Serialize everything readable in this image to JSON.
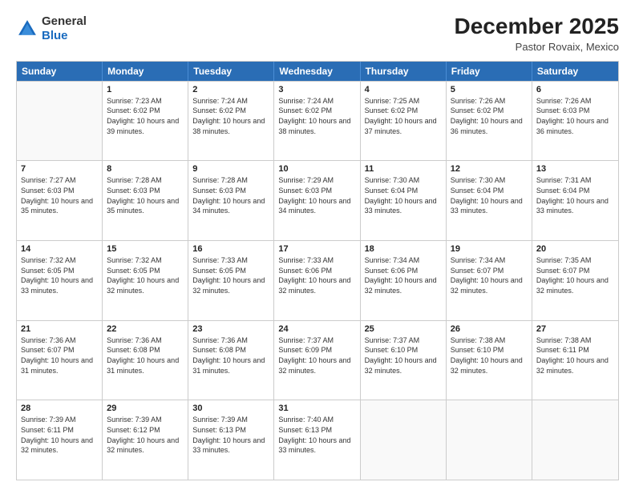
{
  "header": {
    "logo_general": "General",
    "logo_blue": "Blue",
    "month_title": "December 2025",
    "location": "Pastor Rovaix, Mexico"
  },
  "weekdays": [
    "Sunday",
    "Monday",
    "Tuesday",
    "Wednesday",
    "Thursday",
    "Friday",
    "Saturday"
  ],
  "weeks": [
    [
      {
        "day": "",
        "empty": true
      },
      {
        "day": "1",
        "sunrise": "7:23 AM",
        "sunset": "6:02 PM",
        "daylight": "10 hours and 39 minutes."
      },
      {
        "day": "2",
        "sunrise": "7:24 AM",
        "sunset": "6:02 PM",
        "daylight": "10 hours and 38 minutes."
      },
      {
        "day": "3",
        "sunrise": "7:24 AM",
        "sunset": "6:02 PM",
        "daylight": "10 hours and 38 minutes."
      },
      {
        "day": "4",
        "sunrise": "7:25 AM",
        "sunset": "6:02 PM",
        "daylight": "10 hours and 37 minutes."
      },
      {
        "day": "5",
        "sunrise": "7:26 AM",
        "sunset": "6:02 PM",
        "daylight": "10 hours and 36 minutes."
      },
      {
        "day": "6",
        "sunrise": "7:26 AM",
        "sunset": "6:03 PM",
        "daylight": "10 hours and 36 minutes."
      }
    ],
    [
      {
        "day": "7",
        "sunrise": "7:27 AM",
        "sunset": "6:03 PM",
        "daylight": "10 hours and 35 minutes."
      },
      {
        "day": "8",
        "sunrise": "7:28 AM",
        "sunset": "6:03 PM",
        "daylight": "10 hours and 35 minutes."
      },
      {
        "day": "9",
        "sunrise": "7:28 AM",
        "sunset": "6:03 PM",
        "daylight": "10 hours and 34 minutes."
      },
      {
        "day": "10",
        "sunrise": "7:29 AM",
        "sunset": "6:03 PM",
        "daylight": "10 hours and 34 minutes."
      },
      {
        "day": "11",
        "sunrise": "7:30 AM",
        "sunset": "6:04 PM",
        "daylight": "10 hours and 33 minutes."
      },
      {
        "day": "12",
        "sunrise": "7:30 AM",
        "sunset": "6:04 PM",
        "daylight": "10 hours and 33 minutes."
      },
      {
        "day": "13",
        "sunrise": "7:31 AM",
        "sunset": "6:04 PM",
        "daylight": "10 hours and 33 minutes."
      }
    ],
    [
      {
        "day": "14",
        "sunrise": "7:32 AM",
        "sunset": "6:05 PM",
        "daylight": "10 hours and 33 minutes."
      },
      {
        "day": "15",
        "sunrise": "7:32 AM",
        "sunset": "6:05 PM",
        "daylight": "10 hours and 32 minutes."
      },
      {
        "day": "16",
        "sunrise": "7:33 AM",
        "sunset": "6:05 PM",
        "daylight": "10 hours and 32 minutes."
      },
      {
        "day": "17",
        "sunrise": "7:33 AM",
        "sunset": "6:06 PM",
        "daylight": "10 hours and 32 minutes."
      },
      {
        "day": "18",
        "sunrise": "7:34 AM",
        "sunset": "6:06 PM",
        "daylight": "10 hours and 32 minutes."
      },
      {
        "day": "19",
        "sunrise": "7:34 AM",
        "sunset": "6:07 PM",
        "daylight": "10 hours and 32 minutes."
      },
      {
        "day": "20",
        "sunrise": "7:35 AM",
        "sunset": "6:07 PM",
        "daylight": "10 hours and 32 minutes."
      }
    ],
    [
      {
        "day": "21",
        "sunrise": "7:36 AM",
        "sunset": "6:07 PM",
        "daylight": "10 hours and 31 minutes."
      },
      {
        "day": "22",
        "sunrise": "7:36 AM",
        "sunset": "6:08 PM",
        "daylight": "10 hours and 31 minutes."
      },
      {
        "day": "23",
        "sunrise": "7:36 AM",
        "sunset": "6:08 PM",
        "daylight": "10 hours and 31 minutes."
      },
      {
        "day": "24",
        "sunrise": "7:37 AM",
        "sunset": "6:09 PM",
        "daylight": "10 hours and 32 minutes."
      },
      {
        "day": "25",
        "sunrise": "7:37 AM",
        "sunset": "6:10 PM",
        "daylight": "10 hours and 32 minutes."
      },
      {
        "day": "26",
        "sunrise": "7:38 AM",
        "sunset": "6:10 PM",
        "daylight": "10 hours and 32 minutes."
      },
      {
        "day": "27",
        "sunrise": "7:38 AM",
        "sunset": "6:11 PM",
        "daylight": "10 hours and 32 minutes."
      }
    ],
    [
      {
        "day": "28",
        "sunrise": "7:39 AM",
        "sunset": "6:11 PM",
        "daylight": "10 hours and 32 minutes."
      },
      {
        "day": "29",
        "sunrise": "7:39 AM",
        "sunset": "6:12 PM",
        "daylight": "10 hours and 32 minutes."
      },
      {
        "day": "30",
        "sunrise": "7:39 AM",
        "sunset": "6:13 PM",
        "daylight": "10 hours and 33 minutes."
      },
      {
        "day": "31",
        "sunrise": "7:40 AM",
        "sunset": "6:13 PM",
        "daylight": "10 hours and 33 minutes."
      },
      {
        "day": "",
        "empty": true
      },
      {
        "day": "",
        "empty": true
      },
      {
        "day": "",
        "empty": true
      }
    ]
  ]
}
